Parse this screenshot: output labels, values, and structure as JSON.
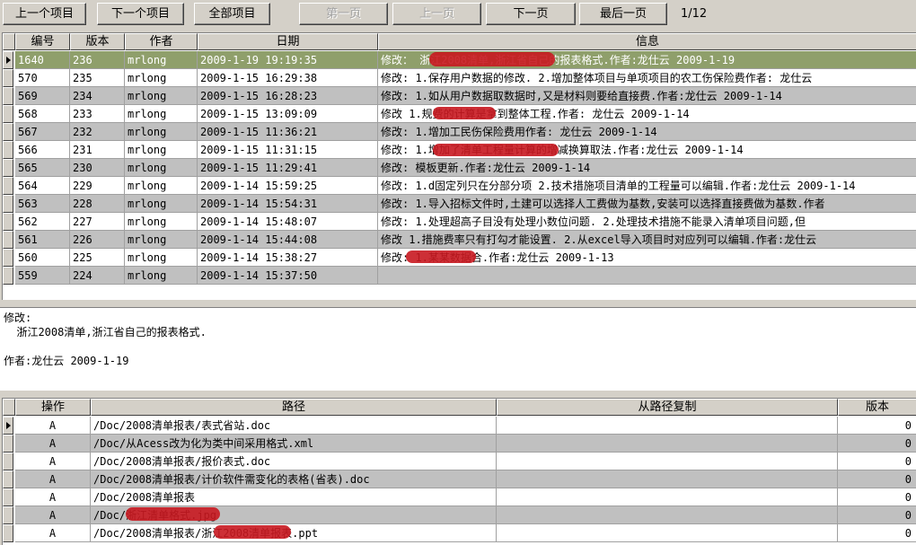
{
  "toolbar": {
    "prev_project": "上一个项目",
    "next_project": "下一个项目",
    "all_projects": "全部项目",
    "first_page": "第一页",
    "prev_page": "上一页",
    "next_page": "下一页",
    "last_page": "最后一页",
    "page_indicator": "1/12"
  },
  "log_table": {
    "headers": [
      "编号",
      "版本",
      "作者",
      "日期",
      "信息"
    ],
    "rows": [
      {
        "id": "1640",
        "rev": "236",
        "author": "mrlong",
        "date": "2009-1-19 19:19:35",
        "info": "修改：  浙江2008清单,浙江省自己的报表格式.作者:龙仕云 2009-1-19"
      },
      {
        "id": "570",
        "rev": "235",
        "author": "mrlong",
        "date": "2009-1-15 16:29:38",
        "info": "修改:  1.保存用户数据的修改.   2.增加整体项目与单项项目的农工伤保险费作者: 龙仕云"
      },
      {
        "id": "569",
        "rev": "234",
        "author": "mrlong",
        "date": "2009-1-15 16:28:23",
        "info": "修改:  1.如从用户数据取数据时,又是材料则要给直接费.作者:龙仕云 2009-1-14"
      },
      {
        "id": "568",
        "rev": "233",
        "author": "mrlong",
        "date": "2009-1-15 13:09:09",
        "info": "修改  1.规费的计算是拿到整体工程.作者: 龙仕云 2009-1-14"
      },
      {
        "id": "567",
        "rev": "232",
        "author": "mrlong",
        "date": "2009-1-15 11:36:21",
        "info": "修改:  1.增加工民伤保险费用作者: 龙仕云 2009-1-14"
      },
      {
        "id": "566",
        "rev": "231",
        "author": "mrlong",
        "date": "2009-1-15 11:31:15",
        "info": "修改:  1.增加了清单工程量计算的增减换算取法.作者:龙仕云 2009-1-14"
      },
      {
        "id": "565",
        "rev": "230",
        "author": "mrlong",
        "date": "2009-1-15 11:29:41",
        "info": "修改:  模板更新.作者:龙仕云 2009-1-14"
      },
      {
        "id": "564",
        "rev": "229",
        "author": "mrlong",
        "date": "2009-1-14 15:59:25",
        "info": "修改:  1.d固定列只在分部分项   2.技术措施项目清单的工程量可以编辑.作者:龙仕云 2009-1-14"
      },
      {
        "id": "563",
        "rev": "228",
        "author": "mrlong",
        "date": "2009-1-14 15:54:31",
        "info": "修改:  1.导入招标文件时,土建可以选择人工费做为基数,安装可以选择直接费做为基数.作者"
      },
      {
        "id": "562",
        "rev": "227",
        "author": "mrlong",
        "date": "2009-1-14 15:48:07",
        "info": "修改:  1.处理超高子目没有处理小数位问题.   2.处理技术措施不能录入清单项目问题,但"
      },
      {
        "id": "561",
        "rev": "226",
        "author": "mrlong",
        "date": "2009-1-14 15:44:08",
        "info": "修改  1.措施费率只有打勾才能设置.   2.从excel导入项目时对应列可以编辑.作者:龙仕云"
      },
      {
        "id": "560",
        "rev": "225",
        "author": "mrlong",
        "date": "2009-1-14 15:38:27",
        "info": "修改:  1.某某数据合.作者:龙仕云 2009-1-13"
      },
      {
        "id": "559",
        "rev": "224",
        "author": "mrlong",
        "date": "2009-1-14 15:37:50",
        "info": ""
      }
    ]
  },
  "detail": {
    "text": "修改:\n  浙江2008清单,浙江省自己的报表格式.\n\n作者:龙仕云 2009-1-19"
  },
  "files_table": {
    "headers": [
      "操作",
      "路径",
      "从路径复制",
      "版本"
    ],
    "rows": [
      {
        "op": "A",
        "path": "/Doc/2008清单报表/表式省站.doc",
        "copy_from": "",
        "rev": "0"
      },
      {
        "op": "A",
        "path": "/Doc/从Acess改为化为类中间采用格式.xml",
        "copy_from": "",
        "rev": "0"
      },
      {
        "op": "A",
        "path": "/Doc/2008清单报表/报价表式.doc",
        "copy_from": "",
        "rev": "0"
      },
      {
        "op": "A",
        "path": "/Doc/2008清单报表/计价软件需变化的表格(省表).doc",
        "copy_from": "",
        "rev": "0"
      },
      {
        "op": "A",
        "path": "/Doc/2008清单报表",
        "copy_from": "",
        "rev": "0"
      },
      {
        "op": "A",
        "path": "/Doc/浙江清单格式.jpg",
        "copy_from": "",
        "rev": "0"
      },
      {
        "op": "A",
        "path": "/Doc/2008清单报表/浙江2008清单报表.ppt",
        "copy_from": "",
        "rev": "0"
      }
    ]
  }
}
